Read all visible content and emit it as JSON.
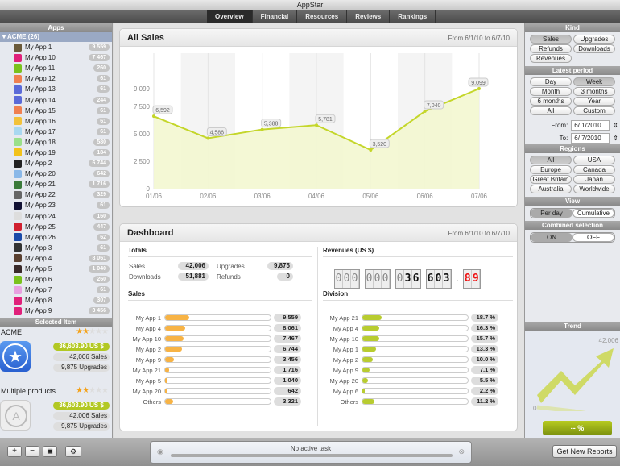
{
  "window": {
    "title": "AppStar"
  },
  "tabs": [
    "Overview",
    "Financial",
    "Resources",
    "Reviews",
    "Rankings"
  ],
  "sidebar": {
    "header": "Apps",
    "group": "ACME (26)",
    "apps": [
      {
        "name": "My App 1",
        "count": "9 559",
        "color": "#6b5a3a"
      },
      {
        "name": "My App 10",
        "count": "7 467",
        "color": "#e0207a"
      },
      {
        "name": "My App 11",
        "count": "260",
        "color": "#7ac21c"
      },
      {
        "name": "My App 12",
        "count": "61",
        "color": "#f08050"
      },
      {
        "name": "My App 13",
        "count": "61",
        "color": "#5a6ad8"
      },
      {
        "name": "My App 14",
        "count": "244",
        "color": "#5a6ad8"
      },
      {
        "name": "My App 15",
        "count": "61",
        "color": "#f08050"
      },
      {
        "name": "My App 16",
        "count": "61",
        "color": "#f2c23a"
      },
      {
        "name": "My App 17",
        "count": "61",
        "color": "#a8d8f0"
      },
      {
        "name": "My App 18",
        "count": "580",
        "color": "#9ae08a"
      },
      {
        "name": "My App 19",
        "count": "184",
        "color": "#f2c21a"
      },
      {
        "name": "My App 2",
        "count": "6 744",
        "color": "#222222"
      },
      {
        "name": "My App 20",
        "count": "642",
        "color": "#8ab8e8"
      },
      {
        "name": "My App 21",
        "count": "1 716",
        "color": "#3a7a3a"
      },
      {
        "name": "My App 22",
        "count": "329",
        "color": "#666666"
      },
      {
        "name": "My App 23",
        "count": "61",
        "color": "#111133"
      },
      {
        "name": "My App 24",
        "count": "160",
        "color": "#dddddd"
      },
      {
        "name": "My App 25",
        "count": "447",
        "color": "#d02030"
      },
      {
        "name": "My App 26",
        "count": "62",
        "color": "#1a4aa8"
      },
      {
        "name": "My App 3",
        "count": "61",
        "color": "#333333"
      },
      {
        "name": "My App 4",
        "count": "8 061",
        "color": "#5a4030"
      },
      {
        "name": "My App 5",
        "count": "1 040",
        "color": "#3a2a2a"
      },
      {
        "name": "My App 6",
        "count": "260",
        "color": "#7ac21c"
      },
      {
        "name": "My App 7",
        "count": "61",
        "color": "#e8a0e0"
      },
      {
        "name": "My App 8",
        "count": "307",
        "color": "#e0207a"
      },
      {
        "name": "My App 9",
        "count": "3 456",
        "color": "#e0207a"
      }
    ]
  },
  "selected": {
    "header": "Selected Item",
    "items": [
      {
        "title": "ACME",
        "rating": 2,
        "revenue": "36,603.90 US $",
        "sales": "42,006 Sales",
        "upgrades": "9,875 Upgrades"
      },
      {
        "title": "Multiple products",
        "rating": 2,
        "revenue": "36,603.90 US $",
        "sales": "42,006 Sales",
        "upgrades": "9,875 Upgrades"
      }
    ]
  },
  "all_sales": {
    "title": "All Sales",
    "range": "From 6/1/10 to 6/7/10"
  },
  "chart_data": {
    "type": "area",
    "title": "All Sales",
    "x": [
      "01/06",
      "02/06",
      "03/06",
      "04/06",
      "05/06",
      "06/06",
      "07/06"
    ],
    "values": [
      6592,
      4586,
      5388,
      5781,
      3520,
      7040,
      9099
    ],
    "labels": [
      "6,592",
      "4,586",
      "5,388",
      "5,781",
      "3,520",
      "7,040",
      "9,099"
    ],
    "yticks": [
      0,
      2500,
      5000,
      7500,
      9099
    ],
    "ytick_labels": [
      "0",
      "2,500",
      "5,000",
      "7,500",
      "9,099"
    ],
    "ylim": [
      0,
      9099
    ],
    "color": "#c4d62a"
  },
  "dashboard": {
    "title": "Dashboard",
    "range": "From 6/1/10 to 6/7/10",
    "totals": {
      "title": "Totals",
      "items": [
        [
          "Sales",
          "42,006"
        ],
        [
          "Downloads",
          "51,881"
        ],
        [
          "Upgrades",
          "9,875"
        ],
        [
          "Refunds",
          "0"
        ]
      ]
    },
    "revenues": {
      "title": "Revenues (US $)",
      "digits": "000000036603",
      "cents": "89"
    },
    "sales": {
      "title": "Sales",
      "rows": [
        [
          "My App 1",
          9559,
          "9,559"
        ],
        [
          "My App 4",
          8061,
          "8,061"
        ],
        [
          "My App 10",
          7467,
          "7,467"
        ],
        [
          "My App 2",
          6744,
          "6,744"
        ],
        [
          "My App 9",
          3456,
          "3,456"
        ],
        [
          "My App 21",
          1716,
          "1,716"
        ],
        [
          "My App 5",
          1040,
          "1,040"
        ],
        [
          "My App 20",
          642,
          "642"
        ],
        [
          "Others",
          3321,
          "3,321"
        ]
      ],
      "color": "#f7b345"
    },
    "division": {
      "title": "Division",
      "rows": [
        [
          "My App 21",
          18.7,
          "18.7 %"
        ],
        [
          "My App 4",
          16.3,
          "16.3 %"
        ],
        [
          "My App 10",
          15.7,
          "15.7 %"
        ],
        [
          "My App 1",
          13.3,
          "13.3 %"
        ],
        [
          "My App 2",
          10.0,
          "10.0 %"
        ],
        [
          "My App 9",
          7.1,
          "7.1 %"
        ],
        [
          "My App 20",
          5.5,
          "5.5 %"
        ],
        [
          "My App 6",
          2.2,
          "2.2 %"
        ],
        [
          "Others",
          11.2,
          "11.2 %"
        ]
      ],
      "color": "#b8cc30"
    }
  },
  "right": {
    "kind": {
      "header": "Kind",
      "options": [
        "Sales",
        "Upgrades",
        "Refunds",
        "Downloads",
        "Revenues"
      ],
      "selected": "Sales"
    },
    "period": {
      "header": "Latest period",
      "options": [
        "Day",
        "Week",
        "Month",
        "3 months",
        "6 months",
        "Year",
        "All",
        "Custom"
      ],
      "selected": "Week",
      "from_label": "From:",
      "from": "6/ 1/2010",
      "to_label": "To:",
      "to": "6/ 7/2010"
    },
    "regions": {
      "header": "Regions",
      "options": [
        "All",
        "USA",
        "Europe",
        "Canada",
        "Great Britain",
        "Japan",
        "Australia",
        "Worldwide"
      ],
      "selected": "All"
    },
    "view": {
      "header": "View",
      "options": [
        "Per day",
        "Cumulative"
      ],
      "selected": "Per day"
    },
    "combined": {
      "header": "Combined selection",
      "options": [
        "ON",
        "OFF"
      ],
      "selected": "ON"
    },
    "trend": {
      "header": "Trend",
      "max": "42,006",
      "min": "0",
      "percent": "-- %"
    }
  },
  "bottom": {
    "task": "No active task",
    "get_reports": "Get New Reports"
  }
}
